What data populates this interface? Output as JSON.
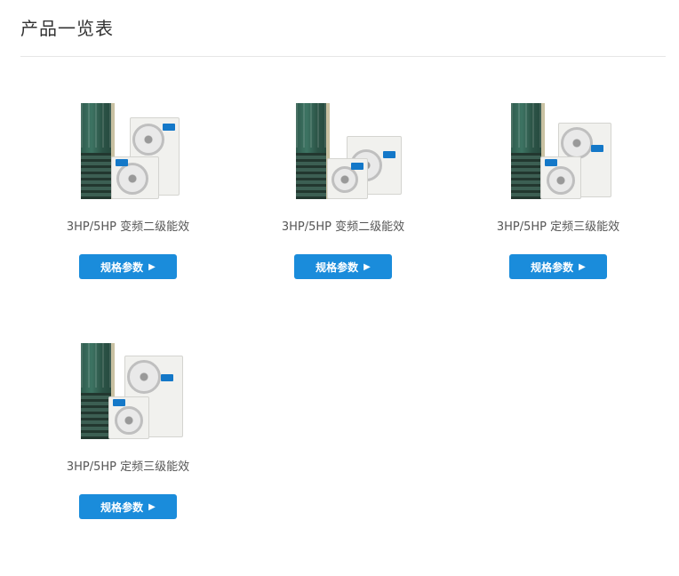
{
  "page": {
    "title": "产品一览表"
  },
  "products": [
    {
      "name": "3HP/5HP 变频二级能效",
      "button_label": "规格参数",
      "arrow_icon": "play-arrow-icon"
    },
    {
      "name": "3HP/5HP 变频二级能效",
      "button_label": "规格参数",
      "arrow_icon": "play-arrow-icon"
    },
    {
      "name": "3HP/5HP 定频三级能效",
      "button_label": "规格参数",
      "arrow_icon": "play-arrow-icon"
    },
    {
      "name": "3HP/5HP 定频三级能效",
      "button_label": "规格参数",
      "arrow_icon": "play-arrow-icon"
    }
  ],
  "colors": {
    "button": "#1a8cdb",
    "divider": "#e6e6e6",
    "title": "#333333"
  }
}
